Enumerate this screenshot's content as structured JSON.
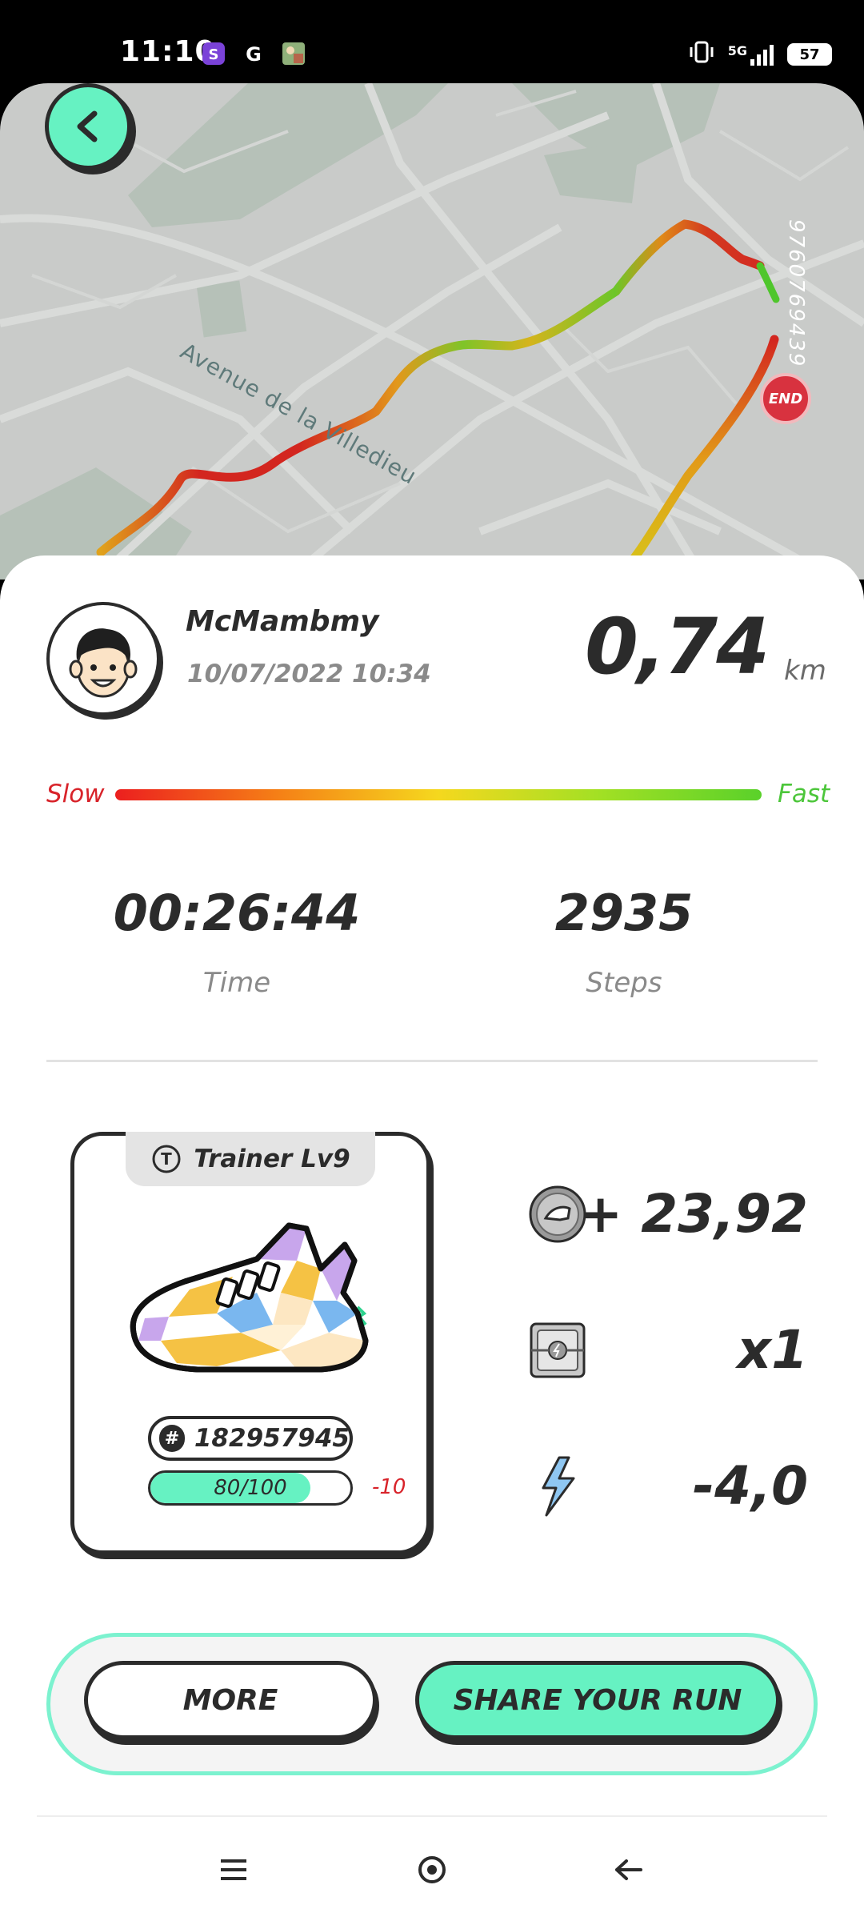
{
  "status_bar": {
    "time": "11:10",
    "network": "5G",
    "battery": "57",
    "icons": [
      "s-app-icon",
      "g-app-icon",
      "photo-app-icon",
      "vibrate-icon",
      "signal-icon",
      "battery-icon"
    ]
  },
  "map": {
    "street_name": "Avenue de la Villedieu",
    "map_id": "9760769439",
    "end_label": "END"
  },
  "profile": {
    "username": "McMambmy",
    "date": "10/07/2022 10:34"
  },
  "distance": {
    "value": "0,74",
    "unit": "km"
  },
  "speed_legend": {
    "slow": "Slow",
    "fast": "Fast",
    "colors": [
      "#ec1f1f",
      "#f57f16",
      "#f5d81e",
      "#a2e024",
      "#5ad12a"
    ]
  },
  "stats": {
    "time_value": "00:26:44",
    "time_label": "Time",
    "steps_value": "2935",
    "steps_label": "Steps"
  },
  "shoe": {
    "type": "Trainer Lv9",
    "id": "182957945",
    "durability_text": "80/100",
    "durability_fraction": 0.8,
    "durability_change": "-10"
  },
  "rewards": {
    "tokens": "+ 23,92",
    "mystery_box": "x1",
    "energy": "-4,0"
  },
  "buttons": {
    "more": "MORE",
    "share": "SHARE YOUR RUN"
  },
  "colors": {
    "accent": "#66f2c2",
    "dark": "#2b2b2b",
    "end_marker": "#d8323f"
  }
}
